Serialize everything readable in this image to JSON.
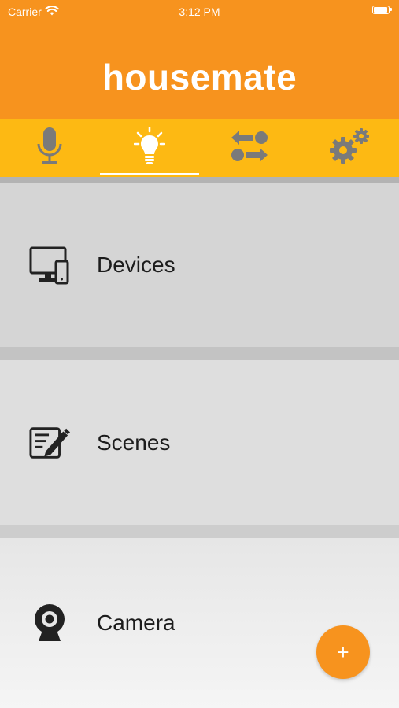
{
  "status_bar": {
    "carrier": "Carrier",
    "time": "3:12 PM"
  },
  "header": {
    "title": "housemate"
  },
  "tabs": [
    {
      "name": "Voice",
      "icon": "microphone-icon",
      "active": false
    },
    {
      "name": "Control",
      "icon": "lightbulb-icon",
      "active": true
    },
    {
      "name": "Automation",
      "icon": "swap-arrows-icon",
      "active": false
    },
    {
      "name": "Settings",
      "icon": "gears-icon",
      "active": false
    }
  ],
  "menu": {
    "items": [
      {
        "label": "Devices",
        "icon": "devices-icon"
      },
      {
        "label": "Scenes",
        "icon": "scenes-icon"
      },
      {
        "label": "Camera",
        "icon": "camera-icon"
      }
    ]
  },
  "fab": {
    "label": "+"
  },
  "colors": {
    "header_orange": "#F7931E",
    "tabbar_yellow": "#FDB913",
    "tab_icon_gray": "#7a7a7a",
    "active_tab_white": "#ffffff"
  }
}
